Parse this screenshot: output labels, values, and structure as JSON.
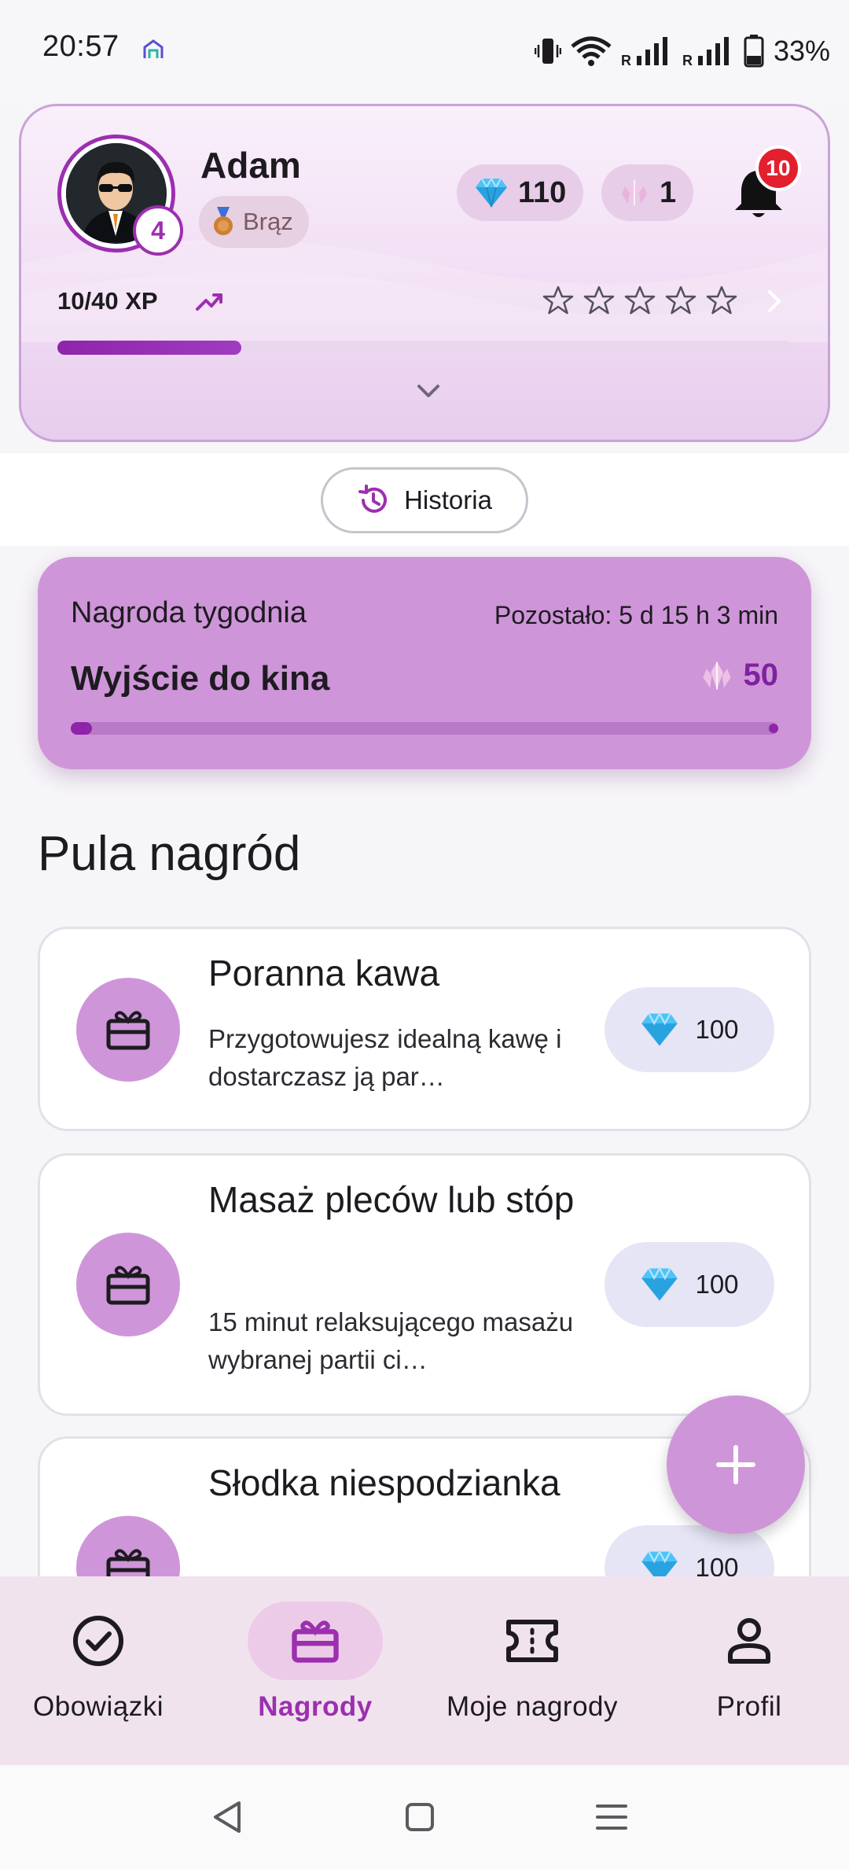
{
  "status_bar": {
    "time": "20:57",
    "battery": "33%",
    "network_tags": [
      "R",
      "R"
    ]
  },
  "profile": {
    "name": "Adam",
    "level": "4",
    "rank": "Brąz",
    "gems": "110",
    "crystals": "1",
    "notifications": "10",
    "xp_text": "10/40 XP",
    "xp_progress": 0.25,
    "stars_filled": 0,
    "stars_total": 5
  },
  "history_button": {
    "label": "Historia"
  },
  "weekly": {
    "title": "Nagroda tygodnia",
    "remaining": "Pozostało: 5 d 15 h 3 min",
    "reward_name": "Wyjście do kina",
    "cost": "50",
    "progress": 0.02
  },
  "pool": {
    "title": "Pula nagród",
    "rewards": [
      {
        "name": "Poranna kawa",
        "description": "Przygotowujesz idealną kawę i dostarczasz ją par…",
        "cost": "100"
      },
      {
        "name": "Masaż pleców lub stóp",
        "description": "15 minut relaksującego masażu wybranej partii ci…",
        "cost": "100"
      },
      {
        "name": "Słodka niespodzianka",
        "description": "",
        "cost": "100"
      }
    ]
  },
  "fab": {
    "icon": "plus-icon"
  },
  "nav": {
    "items": [
      {
        "label": "Obowiązki",
        "icon": "check-circle-icon"
      },
      {
        "label": "Nagrody",
        "icon": "gift-icon",
        "active": true
      },
      {
        "label": "Moje nagrody",
        "icon": "ticket-icon"
      },
      {
        "label": "Profil",
        "icon": "person-icon"
      }
    ]
  },
  "colors": {
    "accent": "#9c2fb0",
    "card_purple": "#cf95d9",
    "badge_red": "#e3202e"
  }
}
